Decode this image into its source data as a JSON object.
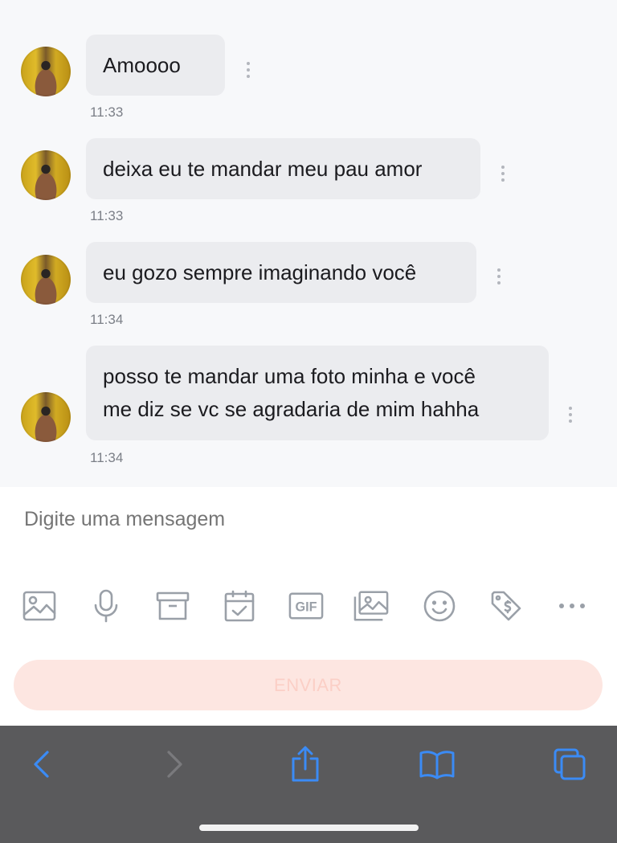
{
  "messages": [
    {
      "text": "Amoooo",
      "time": "11:33"
    },
    {
      "text": "deixa eu te mandar meu pau amor",
      "time": "11:33"
    },
    {
      "text": "eu gozo sempre imaginando você",
      "time": "11:34"
    },
    {
      "text_line1": "posso te mandar uma foto minha e você",
      "text_line2": "me diz se vc se agradaria de mim hahha",
      "time": "11:34"
    }
  ],
  "composer": {
    "placeholder": "Digite uma mensagem",
    "send_label": "ENVIAR",
    "tools": [
      "image-icon",
      "microphone-icon",
      "archive-icon",
      "calendar-check-icon",
      "gif-icon",
      "gallery-icon",
      "emoji-icon",
      "price-tag-icon",
      "more-icon"
    ],
    "gif_label": "GIF"
  },
  "colors": {
    "accent_send": "#fde6e1",
    "browser_icons": "#3b8bf5",
    "bubble": "#ebecef"
  },
  "browser": {
    "buttons": [
      "back-icon",
      "forward-icon",
      "share-icon",
      "bookmarks-icon",
      "tabs-icon"
    ]
  }
}
